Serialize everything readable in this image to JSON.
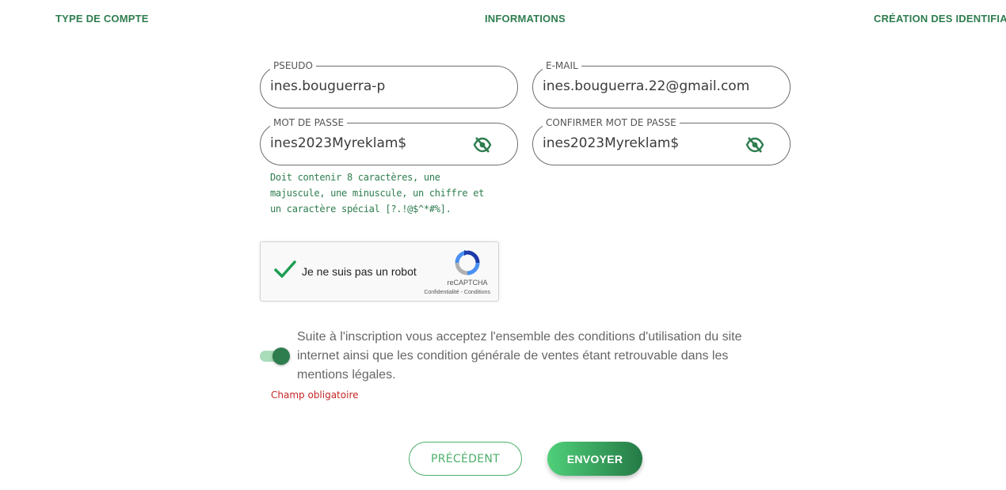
{
  "steps": [
    "TYPE DE COMPTE",
    "INFORMATIONS",
    "CRÉATION DES IDENTIFIA"
  ],
  "fields": {
    "pseudo": {
      "label": "PSEUDO",
      "value": "ines.bouguerra-p"
    },
    "email": {
      "label": "E-MAIL",
      "value": "ines.bouguerra.22@gmail.com"
    },
    "password": {
      "label": "MOT DE PASSE",
      "value": "ines2023Myreklam$",
      "icon": "eye-off-icon"
    },
    "confirm": {
      "label": "CONFIRMER MOT DE PASSE",
      "value": "ines2023Myreklam$",
      "icon": "eye-off-icon"
    }
  },
  "password_hint": "Doit contenir 8 caractères, une majuscule, une minuscule, un chiffre et un caractère spécial [?.!@$^*#%].",
  "captcha": {
    "label": "Je ne suis pas un robot",
    "checked": true,
    "brand": "reCAPTCHA",
    "links": "Confidentialité - Conditions"
  },
  "terms": {
    "enabled": true,
    "text": "Suite à l'inscription vous acceptez l'ensemble des conditions d'utilisation du site internet ainsi que les condition générale de ventes étant retrouvable dans les mentions légales.",
    "error": "Champ obligatoire"
  },
  "buttons": {
    "previous": "PRÉCÉDENT",
    "submit": "ENVOYER"
  },
  "colors": {
    "accent": "#2e7d4f",
    "error": "#c62828",
    "button_gradient_start": "#4fd07a",
    "button_gradient_end": "#247a45"
  }
}
